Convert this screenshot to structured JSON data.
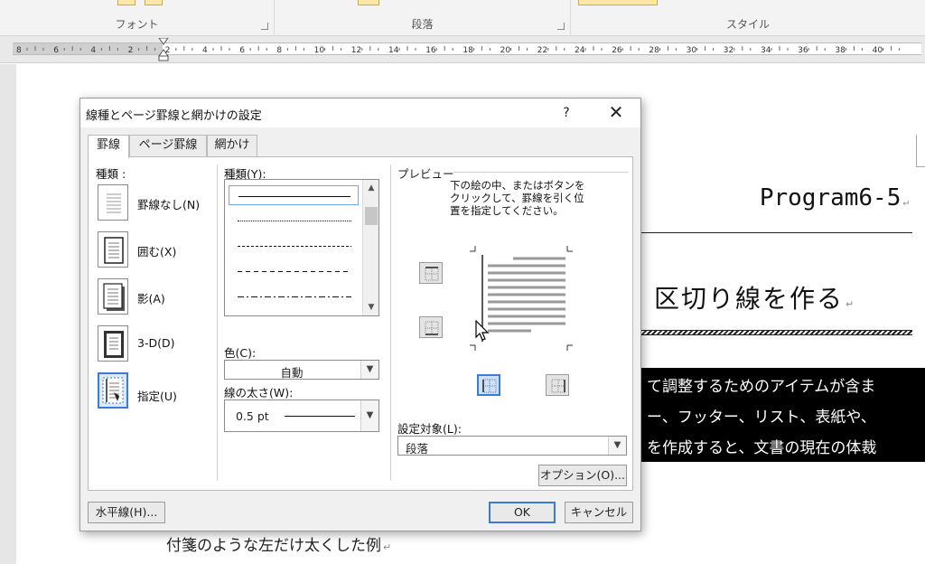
{
  "ribbon": {
    "groups": [
      {
        "label": "フォント"
      },
      {
        "label": "段落"
      },
      {
        "label": "スタイル"
      }
    ]
  },
  "ruler": {
    "ticks": [
      "8",
      "6",
      "4",
      "2",
      "2",
      "4",
      "6",
      "8",
      "10",
      "12",
      "14",
      "16",
      "18",
      "20",
      "22",
      "24",
      "26",
      "28",
      "30",
      "32",
      "34",
      "36",
      "38",
      "40"
    ]
  },
  "document": {
    "title": "Program6-5",
    "heading": "区切り線を作る",
    "black_lines": [
      "て調整するためのアイテムが含ま",
      "ー、フッター、リスト、表紙や、",
      "を作成すると、文書の現在の体裁"
    ],
    "caption": "付箋のような左だけ太くした例",
    "return_mark": "↵"
  },
  "dialog": {
    "title": "線種とページ罫線と網かけの設定",
    "help": "?",
    "close": "✕",
    "tabs": [
      {
        "label": "罫線"
      },
      {
        "label": "ページ罫線"
      },
      {
        "label": "網かけ"
      }
    ],
    "setting": {
      "label": "種類 :",
      "items": [
        {
          "label": "罫線なし(N)",
          "icon": "no-border-icon"
        },
        {
          "label": "囲む(X)",
          "icon": "box-border-icon"
        },
        {
          "label": "影(A)",
          "icon": "shadow-border-icon"
        },
        {
          "label": "3-D(D)",
          "icon": "3d-border-icon"
        },
        {
          "label": "指定(U)",
          "icon": "custom-border-icon"
        }
      ]
    },
    "style": {
      "label": "種類(Y):",
      "items": [
        "solid",
        "dotted",
        "dashed-fine",
        "dashed",
        "dash-dot"
      ]
    },
    "color": {
      "label": "色(C):",
      "value": "自動"
    },
    "width": {
      "label": "線の太さ(W):",
      "value": "0.5 pt"
    },
    "preview": {
      "label": "プレビュー",
      "instructions": [
        "下の絵の中、またはボタンを",
        "クリックして、罫線を引く位",
        "置を指定してください。"
      ]
    },
    "apply_to": {
      "label": "設定対象(L):",
      "value": "段落"
    },
    "buttons": {
      "options": "オプション(O)...",
      "horizontal_line": "水平線(H)...",
      "ok": "OK",
      "cancel": "キャンセル"
    }
  },
  "colors": {
    "accent": "#3a7bd5",
    "dialog_bg": "#f0f0f0",
    "ribbon_bg": "#f3f3f3"
  }
}
